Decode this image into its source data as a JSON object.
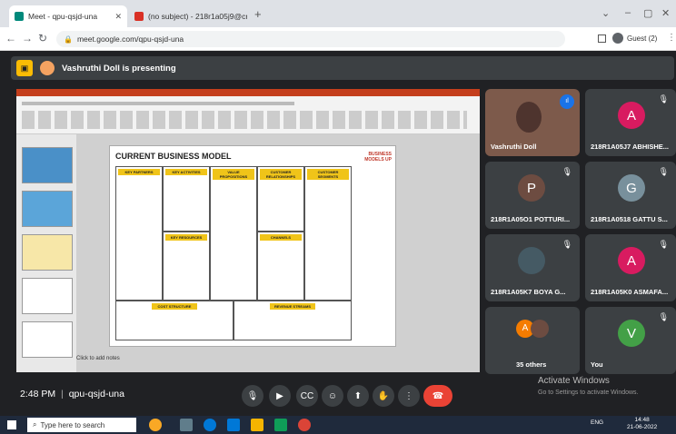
{
  "browser": {
    "tabs": [
      {
        "title": "Meet - qpu-qsjd-una",
        "icon_color": "#00897b"
      },
      {
        "title": "(no subject) - 218r1a05j9@cmr",
        "icon_color": "#d93025"
      }
    ],
    "new_tab": "+",
    "url": "meet.google.com/qpu-qsjd-una",
    "profile": "Guest (2)"
  },
  "presenting": {
    "text": "Vashruthi Doll is presenting"
  },
  "slide": {
    "title": "CURRENT BUSINESS MODEL",
    "logo": "BUSINESS MODELS UP",
    "headers": [
      "KEY PARTNERS",
      "KEY ACTIVITIES",
      "VALUE PROPOSITIONS",
      "CUSTOMER RELATIONSHIPS",
      "CUSTOMER SEGMENTS",
      "KEY RESOURCES",
      "CHANNELS",
      "COST STRUCTURE",
      "REVENUE STREAMS"
    ],
    "notes": "Click to add notes"
  },
  "participants": [
    {
      "name": "Vashruthi Doll",
      "initial": "",
      "color": "#8d6e63"
    },
    {
      "name": "218R1A05J7 ABHISHE...",
      "initial": "A",
      "color": "#d81b60"
    },
    {
      "name": "218R1A05O1 POTTURI...",
      "initial": "P",
      "color": "#6d4c41"
    },
    {
      "name": "218R1A0518 GATTU S...",
      "initial": "G",
      "color": "#78909c"
    },
    {
      "name": "218R1A05K7 BOYA G...",
      "initial": "",
      "color": "#455a64"
    },
    {
      "name": "218R1A05K0 ASMAFA...",
      "initial": "A",
      "color": "#d81b60"
    },
    {
      "name": "35 others",
      "initial": "A",
      "color": "#f57c00"
    },
    {
      "name": "You",
      "initial": "V",
      "color": "#43a047"
    }
  ],
  "meeting": {
    "time": "2:48 PM",
    "code": "qpu-qsjd-una"
  },
  "watermark": {
    "line1": "Activate Windows",
    "line2": "Go to Settings to activate Windows."
  },
  "taskbar": {
    "search_placeholder": "Type here to search",
    "lang": "ENG",
    "time": "14:48",
    "date": "21-06-2022"
  }
}
